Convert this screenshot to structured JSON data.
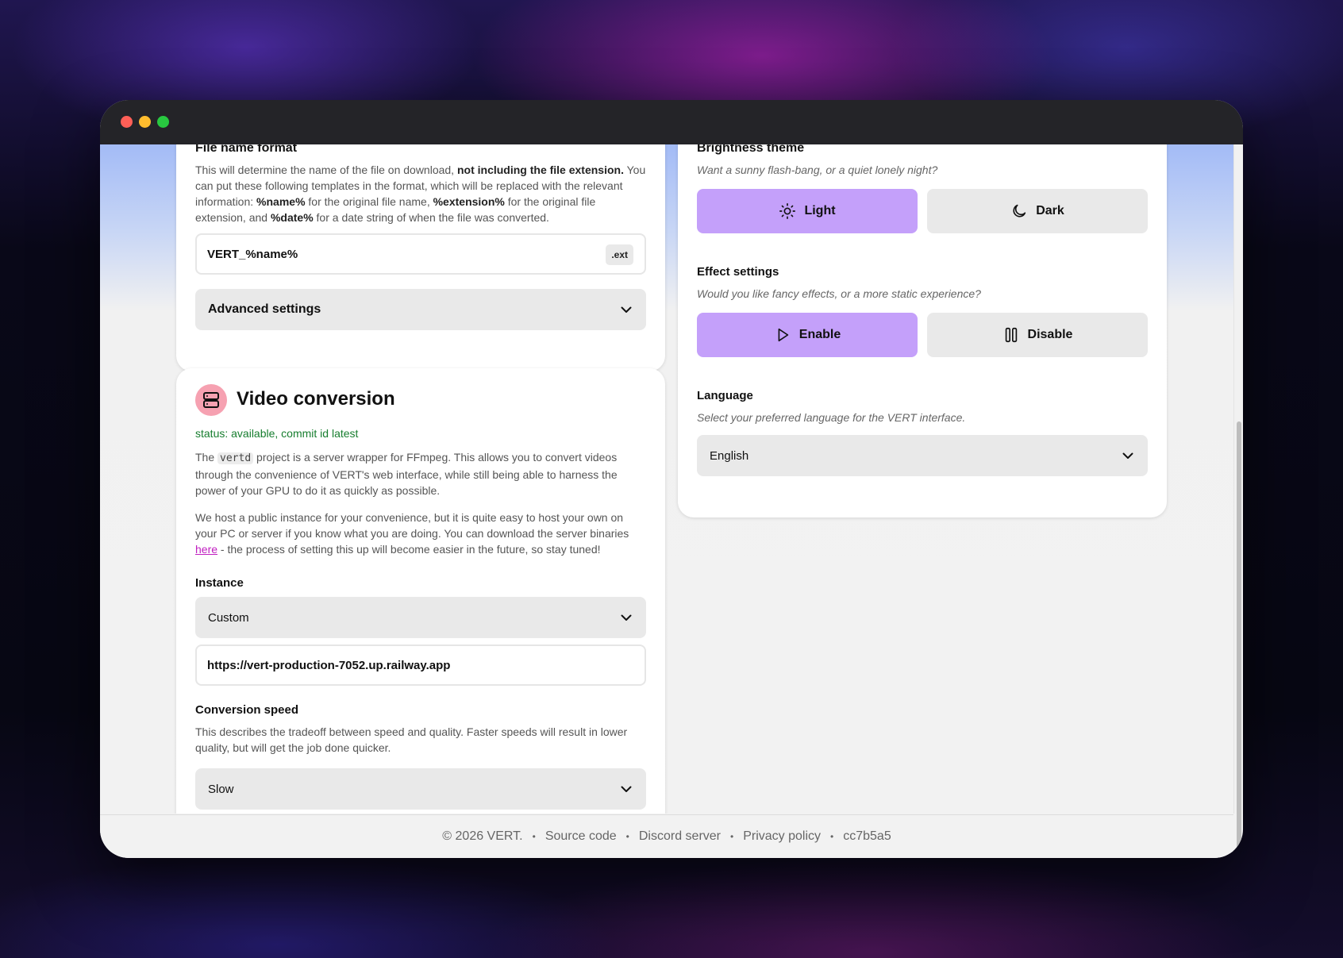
{
  "colors": {
    "accent": "#c4a0fa",
    "status_green": "#167d2e",
    "link": "#c01ec0",
    "video_icon_bg": "#f6a1b1"
  },
  "file_name_format": {
    "heading": "File name format",
    "desc_1": "This will determine the name of the file on download, ",
    "desc_bold_1": "not including the file extension.",
    "desc_2": " You can put these following templates in the format, which will be replaced with the relevant information: ",
    "tpl_name": "%name%",
    "desc_3": " for the original file name, ",
    "tpl_ext": "%extension%",
    "desc_4": " for the original file extension, and ",
    "tpl_date": "%date%",
    "desc_5": " for a date string of when the file was converted.",
    "input_value": "VERT_%name%",
    "ext_badge": ".ext",
    "advanced_label": "Advanced settings"
  },
  "video_conversion": {
    "title": "Video conversion",
    "icon": "server-icon",
    "status": "status: available, commit id latest",
    "p1_a": "The ",
    "p1_code": "vertd",
    "p1_b": " project is a server wrapper for FFmpeg. This allows you to convert videos through the convenience of VERT's web interface, while still being able to harness the power of your GPU to do it as quickly as possible.",
    "p2_a": "We host a public instance for your convenience, but it is quite easy to host your own on your PC or server if you know what you are doing. You can download the server binaries ",
    "p2_link": "here",
    "p2_b": " - the process of setting this up will become easier in the future, so stay tuned!",
    "instance_label": "Instance",
    "instance_selected": "Custom",
    "instance_url": "https://vert-production-7052.up.railway.app",
    "speed_label": "Conversion speed",
    "speed_desc": "This describes the tradeoff between speed and quality. Faster speeds will result in lower quality, but will get the job done quicker.",
    "speed_selected": "Slow"
  },
  "appearance": {
    "brightness_heading": "Brightness theme",
    "brightness_desc": "Want a sunny flash-bang, or a quiet lonely night?",
    "light_label": "Light",
    "dark_label": "Dark",
    "effect_heading": "Effect settings",
    "effect_desc": "Would you like fancy effects, or a more static experience?",
    "enable_label": "Enable",
    "disable_label": "Disable",
    "language_heading": "Language",
    "language_desc": "Select your preferred language for the VERT interface.",
    "language_selected": "English"
  },
  "footer": {
    "copyright": "© 2026 VERT.",
    "source": "Source code",
    "discord": "Discord server",
    "privacy": "Privacy policy",
    "commit": "cc7b5a5",
    "separator": "•"
  }
}
